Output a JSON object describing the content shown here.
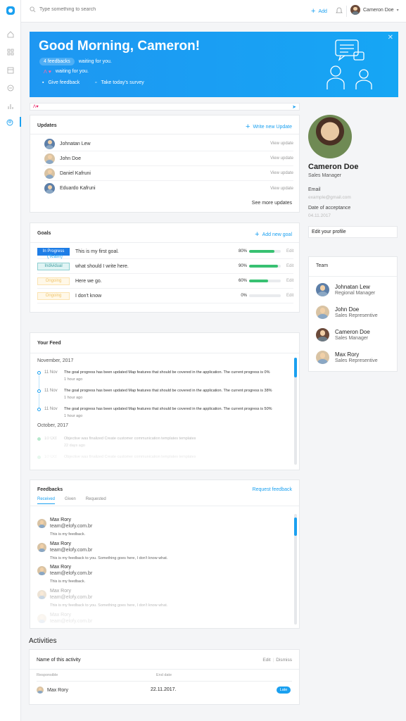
{
  "topbar": {
    "search_placeholder": "Type something to search",
    "add_label": "Add",
    "user_name": "Cameron Doe"
  },
  "hero": {
    "title": "Good Morning, Cameron!",
    "feedbacks_badge": "4 feedbacks",
    "feedbacks_text": "waiting for you.",
    "second_text": "waiting for you.",
    "give_feedback": "Give feedback",
    "survey": "Take today's survey",
    "colors": {
      "accent": "#1aa0f0",
      "badge_pink": "#e91e63"
    }
  },
  "updates": {
    "title": "Updates",
    "write_new": "Write new Update",
    "view_label": "View update",
    "people": [
      "Johnatan Lew",
      "John Doe",
      "Daniel Kafruni",
      "Eduardo Kafruni"
    ],
    "see_more": "See more updates"
  },
  "goals": {
    "title": "Goals",
    "add_new": "Add new goal",
    "edit_label": "Edit",
    "items": [
      {
        "status": "In Progress",
        "text": "This is my first goal.",
        "team": "(Team)",
        "percent": "80%",
        "value": 80
      },
      {
        "status": "Individual",
        "text": "what should I write here.",
        "team": "",
        "percent": "90%",
        "value": 90
      },
      {
        "status": "Ongoing",
        "text": "Here we go.",
        "team": "",
        "percent": "60%",
        "value": 60
      },
      {
        "status": "Ongoing",
        "text": "I don't know",
        "team": "",
        "percent": "0%",
        "value": 0
      }
    ]
  },
  "feed": {
    "title": "Your Feed",
    "month1": "November, 2017",
    "month2": "October, 2017",
    "items": [
      {
        "date": "11 Nov",
        "text": "The goal progress has been updated Map features that should be covered in the application. The current progress is 0%",
        "ago": "1 hour ago"
      },
      {
        "date": "11 Nov",
        "text": "The goal progress has been updated Map features that should be covered in the application. The current progress is 38%",
        "ago": "1 hour ago"
      },
      {
        "date": "11 Nov",
        "text": "The goal progress has been updated Map features that should be covered in the application. The current progress is 50%",
        "ago": "1 hour ago"
      },
      {
        "date": "10 Oct",
        "text": "Objective was finalized Create customer communication templates templates",
        "ago": "22 days ago"
      },
      {
        "date": "10 Oct",
        "text": "Objective was finalized Create customer communication templates templates",
        "ago": ""
      }
    ]
  },
  "feedbacks": {
    "title": "Feedbacks",
    "request": "Request feedback",
    "tabs": [
      "Received",
      "Given",
      "Requested"
    ],
    "items": [
      {
        "name": "Max Rory",
        "email": "team@elofy.com.br",
        "text": "This is my feedback."
      },
      {
        "name": "Max Rory",
        "email": "team@elofy.com.br",
        "text": "This is my feedback to you. Something goes here, I don't know what."
      },
      {
        "name": "Max Rory",
        "email": "team@elofy.com.br",
        "text": "This is my feedback."
      },
      {
        "name": "Max Rory",
        "email": "team@elofy.com.br",
        "text": "This is my feedback to you. Something goes here, I don't know what."
      },
      {
        "name": "Max Rory",
        "email": "team@elofy.com.br",
        "text": ""
      }
    ]
  },
  "activities": {
    "heading": "Activities",
    "name": "Name of this activity",
    "edit": "Edit",
    "dismiss": "Dismiss",
    "col_responsible": "Responsible",
    "col_end": "End date",
    "person": "Max Rory",
    "end_date": "22.11.2017.",
    "badge": "Late"
  },
  "profile": {
    "name": "Cameron Doe",
    "role": "Sales Manager",
    "email_label": "Email",
    "email": "example@gmail.com",
    "date_label": "Date of acceptance",
    "date": "04.11.2017",
    "edit": "Edit your profile"
  },
  "team": {
    "title": "Team",
    "members": [
      {
        "name": "Johnatan Lew",
        "role": "Regional Manager"
      },
      {
        "name": "John Doe",
        "role": "Sales Representive"
      },
      {
        "name": "Cameron Doe",
        "role": "Sales Manager"
      },
      {
        "name": "Max Rory",
        "role": "Sales Representive"
      }
    ]
  }
}
